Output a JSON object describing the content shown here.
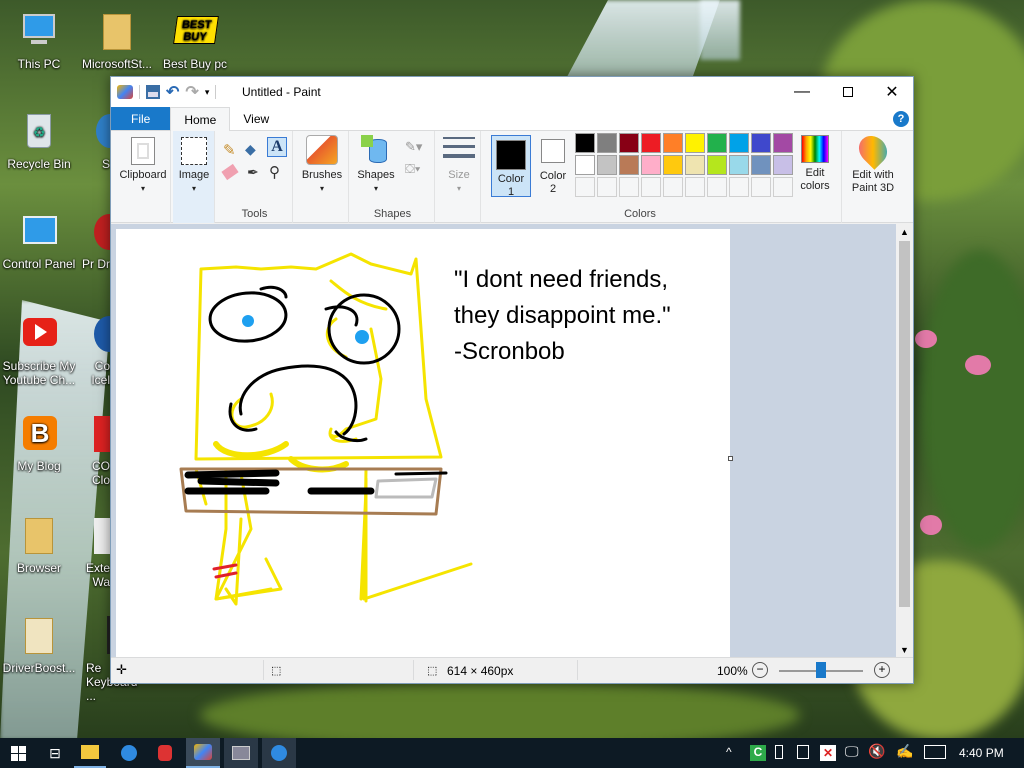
{
  "desktop": {
    "icons": [
      {
        "label": "This PC"
      },
      {
        "label": "MicrosoftSt..."
      },
      {
        "label": "Best Buy pc"
      },
      {
        "label": "Recycle Bin"
      },
      {
        "label": "S"
      },
      {
        "label": "Control Panel"
      },
      {
        "label": "Pr Dr"
      },
      {
        "label": "Subscribe My Youtube Ch..."
      },
      {
        "label": "Co Icel"
      },
      {
        "label": "My Blog"
      },
      {
        "label": "CO Clo"
      },
      {
        "label": "Browser"
      },
      {
        "label": "Exte Wa"
      },
      {
        "label": "DriverBoost..."
      },
      {
        "label": "Re Keyboard ..."
      }
    ],
    "bestbuy_logo": {
      "line1": "BEST",
      "line2": "BUY"
    }
  },
  "paint": {
    "title": "Untitled - Paint",
    "tabs": {
      "file": "File",
      "home": "Home",
      "view": "View"
    },
    "help": "?",
    "ribbon": {
      "clipboard": "Clipboard",
      "image": "Image",
      "tools": "Tools",
      "brushes": "Brushes",
      "shapes_btn": "Shapes",
      "shapes_group": "Shapes",
      "size": "Size",
      "color1": "Color",
      "color1_num": "1",
      "color2": "Color",
      "color2_num": "2",
      "colors_group": "Colors",
      "edit_colors_1": "Edit",
      "edit_colors_2": "colors",
      "edit_paint3d_1": "Edit with",
      "edit_paint3d_2": "Paint 3D",
      "text_tool": "A"
    },
    "palette_row1": [
      "#000000",
      "#7f7f7f",
      "#880015",
      "#ed1c24",
      "#ff7f27",
      "#fff200",
      "#22b14c",
      "#00a2e8",
      "#3f48cc",
      "#a349a4"
    ],
    "palette_row2": [
      "#ffffff",
      "#c3c3c3",
      "#b97a57",
      "#ffaec9",
      "#ffc90e",
      "#efe4b0",
      "#b5e61d",
      "#99d9ea",
      "#7092be",
      "#c8bfe7"
    ],
    "canvas_text": {
      "line1": "\"I dont need friends,",
      "line2": "they disappoint me.\"",
      "line3": "-Scronbob"
    },
    "status": {
      "size": "614 × 460px",
      "zoom": "100%"
    }
  },
  "taskbar": {
    "time": "4:40 PM"
  }
}
